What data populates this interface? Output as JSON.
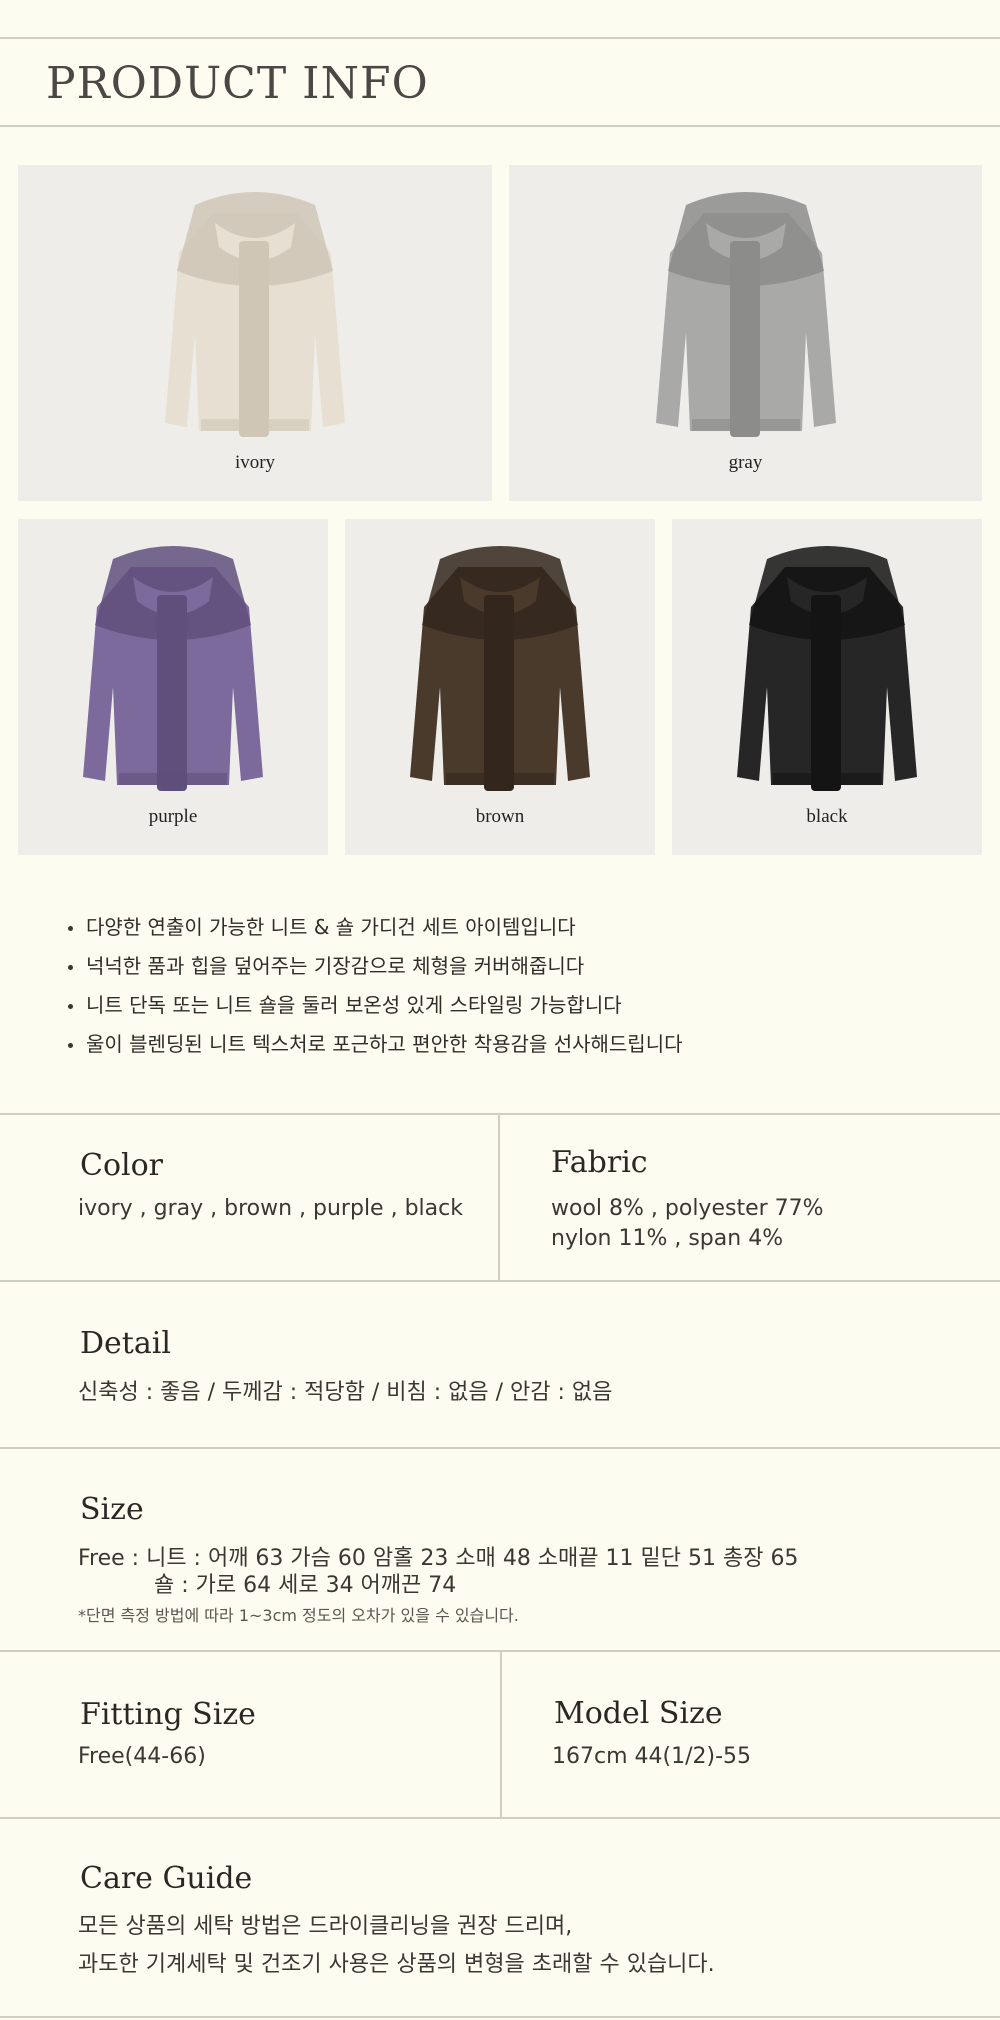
{
  "header": {
    "title": "PRODUCT INFO"
  },
  "products": [
    {
      "caption": "ivory",
      "color": "#e6dfd2",
      "shade": "#cfc6b6"
    },
    {
      "caption": "gray",
      "color": "#a9a9a8",
      "shade": "#8c8c8b"
    },
    {
      "caption": "purple",
      "color": "#7d6a9c",
      "shade": "#5f4f7c"
    },
    {
      "caption": "brown",
      "color": "#4a3a2c",
      "shade": "#33271d"
    },
    {
      "caption": "black",
      "color": "#262626",
      "shade": "#141414"
    }
  ],
  "features": [
    "다양한 연출이 가능한 니트 & 숄 가디건 세트 아이템입니다",
    "넉넉한 품과 힙을 덮어주는 기장감으로 체형을 커버해줍니다",
    "니트 단독 또는 니트 숄을 둘러 보온성 있게 스타일링 가능합니다",
    "울이 블렌딩된 니트 텍스처로 포근하고 편안한 착용감을 선사해드립니다"
  ],
  "specs": {
    "color": {
      "label": "Color",
      "value": "ivory , gray , brown , purple , black"
    },
    "fabric": {
      "label": "Fabric",
      "line1": "wool 8% , polyester 77%",
      "line2": "nylon 11% , span 4%"
    },
    "detail": {
      "label": "Detail",
      "value": "신축성 : 좋음 / 두께감 : 적당함 / 비침 : 없음 / 안감 : 없음"
    },
    "size": {
      "label": "Size",
      "line1": "Free : 니트 : 어깨 63 가슴 60 암홀 23 소매 48 소매끝 11 밑단 51 총장 65",
      "line2": "숄 : 가로 64 세로 34 어깨끈 74",
      "note": "*단면 측정 방법에 따라 1~3cm 정도의 오차가 있을 수 있습니다."
    },
    "fitting": {
      "label": "Fitting Size",
      "value": "Free(44-66)"
    },
    "model": {
      "label": "Model Size",
      "value": "167cm 44(1/2)-55"
    },
    "care": {
      "label": "Care Guide",
      "line1": "모든 상품의 세탁 방법은 드라이클리닝을 권장 드리며,",
      "line2": "과도한 기계세탁 및 건조기 사용은 상품의 변형을 초래할 수 있습니다."
    }
  }
}
